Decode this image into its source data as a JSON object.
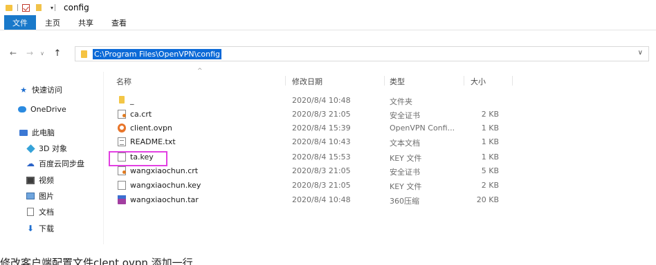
{
  "window": {
    "title": "config"
  },
  "ribbon": {
    "tabs": [
      "文件",
      "主页",
      "共享",
      "查看"
    ]
  },
  "address": {
    "path": "C:\\Program Files\\OpenVPN\\config"
  },
  "sidebar": {
    "items": [
      {
        "label": "快速访问",
        "icon": "star-icon"
      },
      {
        "label": "OneDrive",
        "icon": "cloud-icon"
      },
      {
        "label": "此电脑",
        "icon": "computer-icon"
      },
      {
        "label": "3D 对象",
        "icon": "cube-icon"
      },
      {
        "label": "百度云同步盘",
        "icon": "baidu-icon"
      },
      {
        "label": "视频",
        "icon": "video-icon"
      },
      {
        "label": "图片",
        "icon": "picture-icon"
      },
      {
        "label": "文档",
        "icon": "document-icon"
      },
      {
        "label": "下载",
        "icon": "download-icon"
      }
    ]
  },
  "columns": {
    "name": "名称",
    "date": "修改日期",
    "type": "类型",
    "size": "大小"
  },
  "files": [
    {
      "name": "_",
      "date": "2020/8/4 10:48",
      "type": "文件夹",
      "size": "",
      "icon": "folder-icon"
    },
    {
      "name": "ca.crt",
      "date": "2020/8/3 21:05",
      "type": "安全证书",
      "size": "2 KB",
      "icon": "certificate-icon"
    },
    {
      "name": "client.ovpn",
      "date": "2020/8/4 15:39",
      "type": "OpenVPN Confi...",
      "size": "1 KB",
      "icon": "openvpn-icon"
    },
    {
      "name": "README.txt",
      "date": "2020/8/4 10:43",
      "type": "文本文档",
      "size": "1 KB",
      "icon": "text-file-icon"
    },
    {
      "name": "ta.key",
      "date": "2020/8/4 15:53",
      "type": "KEY 文件",
      "size": "1 KB",
      "icon": "blank-file-icon"
    },
    {
      "name": "wangxiaochun.crt",
      "date": "2020/8/3 21:05",
      "type": "安全证书",
      "size": "5 KB",
      "icon": "certificate-icon"
    },
    {
      "name": "wangxiaochun.key",
      "date": "2020/8/3 21:05",
      "type": "KEY 文件",
      "size": "2 KB",
      "icon": "blank-file-icon"
    },
    {
      "name": "wangxiaochun.tar",
      "date": "2020/8/4 10:48",
      "type": "360压缩",
      "size": "20 KB",
      "icon": "archive-icon"
    }
  ],
  "highlight_color": "#e23fe2",
  "caption": "修改客户端配置文件clent.ovpn 添加一行"
}
